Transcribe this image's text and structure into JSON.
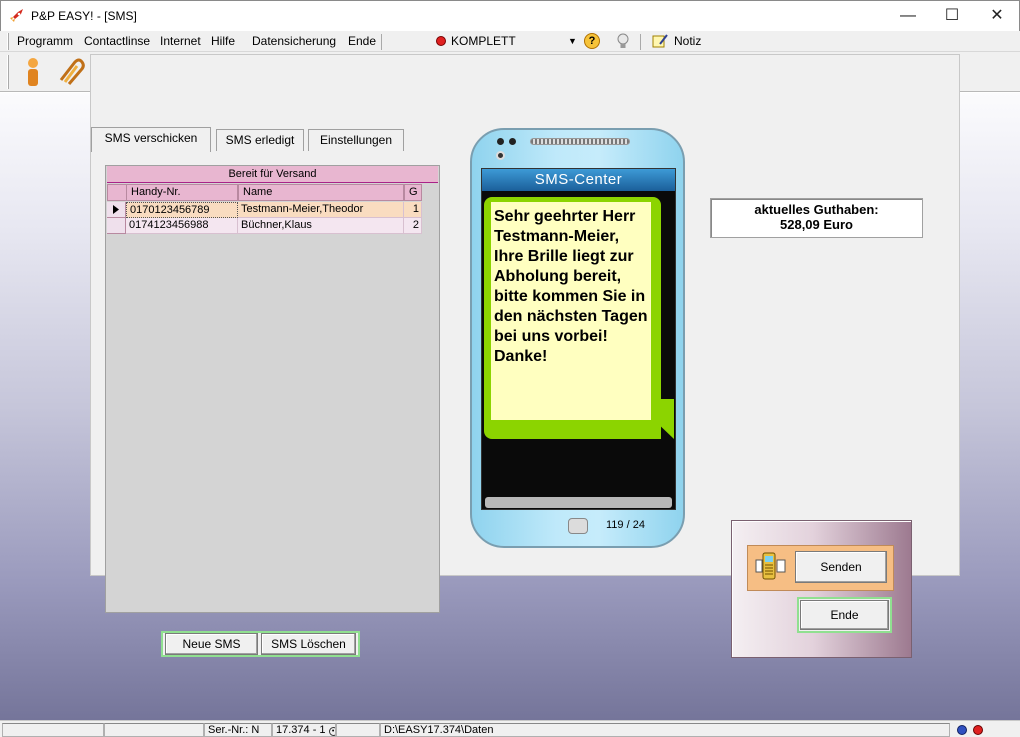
{
  "window": {
    "title": "P&P EASY! - [SMS]"
  },
  "menu": {
    "items": [
      "Programm",
      "Contactlinse",
      "Internet",
      "Hilfe",
      "Datensicherung",
      "Ende"
    ],
    "mode_label": "KOMPLETT",
    "note_label": "Notiz"
  },
  "tabs": [
    "SMS verschicken",
    "SMS erledigt",
    "Einstellungen"
  ],
  "grid": {
    "caption": "Bereit für Versand",
    "columns": [
      "Handy-Nr.",
      "Name",
      "G"
    ],
    "rows": [
      {
        "phone": "0170123456789",
        "name": "Testmann-Meier,Theodor",
        "g": "1"
      },
      {
        "phone": "0174123456988",
        "name": "Büchner,Klaus",
        "g": "2"
      }
    ]
  },
  "buttons": {
    "new_sms": "Neue SMS",
    "delete_sms": "SMS Löschen",
    "send": "Senden",
    "end": "Ende"
  },
  "phone": {
    "header": "SMS-Center",
    "message": "Sehr geehrter Herr Testmann-Meier, Ihre Brille liegt zur Abholung bereit, bitte kommen Sie in den nächsten Tagen bei uns vorbei! Danke!",
    "counter": "119 / 24"
  },
  "credit": {
    "label": "aktuelles  Guthaben:",
    "value": "528,09 Euro"
  },
  "status": {
    "serial": "Ser.-Nr.: N",
    "version": "17.374 - 1",
    "path": "D:\\EASY17.374\\Daten"
  },
  "colors": {
    "grid_header": "#e8b6d0",
    "selected_row": "#f9dcc0",
    "bubble": "#8cd400",
    "phone_body": "#bfe9fa",
    "send_strip": "#f6be84"
  }
}
